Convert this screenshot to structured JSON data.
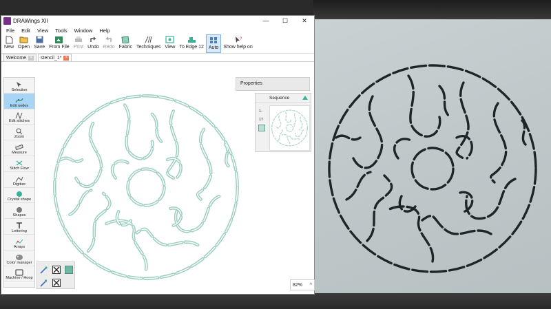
{
  "window": {
    "title": "DRAWings XII",
    "minimize": "—",
    "maximize": "☐",
    "close": "✕"
  },
  "menu": [
    "File",
    "Edit",
    "View",
    "Tools",
    "Window",
    "Help"
  ],
  "toolbar": {
    "new": "New",
    "open": "Open",
    "save": "Save",
    "from_file": "From File",
    "print": "Print",
    "undo": "Undo",
    "redo": "Redo",
    "fabric": "Fabric",
    "techniques": "Techniques",
    "view": "View",
    "to_edge": "To Edge 12",
    "auto": "Auto",
    "show_help": "Show help on"
  },
  "tabs": [
    {
      "label": "Welcome",
      "active": false
    },
    {
      "label": "stencil_1*",
      "active": true
    }
  ],
  "sidebar": {
    "items": [
      {
        "label": "Selection",
        "icon": "selection-arrow-icon"
      },
      {
        "label": "Edit nodes",
        "icon": "edit-nodes-icon",
        "active": true
      },
      {
        "label": "Edit stitches",
        "icon": "edit-stitches-icon"
      },
      {
        "label": "Zoom",
        "icon": "zoom-icon"
      },
      {
        "label": "Measure",
        "icon": "measure-ruler-icon"
      },
      {
        "label": "Stitch Flow",
        "icon": "stitch-flow-icon"
      },
      {
        "label": "Digitize",
        "icon": "digitize-icon"
      },
      {
        "label": "Crystal shape",
        "icon": "crystal-shape-icon"
      },
      {
        "label": "Shapes",
        "icon": "shapes-circle-icon"
      },
      {
        "label": "Lettering",
        "icon": "lettering-t-icon"
      },
      {
        "label": "Arrays",
        "icon": "arrays-icon"
      },
      {
        "label": "Color manager",
        "icon": "color-palette-icon"
      },
      {
        "label": "Machine / Hoop",
        "icon": "machine-hoop-icon"
      }
    ]
  },
  "properties": {
    "title": "Properties"
  },
  "sequence": {
    "title": "Sequence",
    "range_start": "1-",
    "range_end": "17"
  },
  "zoom": {
    "level": "82%",
    "chevron": "^"
  },
  "colors": {
    "accent": "#3ab29a",
    "stencil_line": "#9ccfc2",
    "active_tool": "#a8d4f5",
    "photo_stencil": "#1e2526"
  }
}
